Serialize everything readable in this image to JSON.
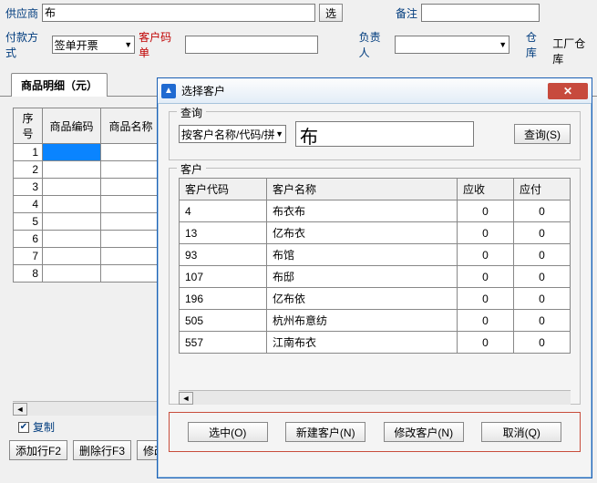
{
  "form": {
    "supplier_label": "供应商",
    "supplier_value": "布",
    "select_btn": "选",
    "remark_label": "备注",
    "remark_value": "",
    "pay_label": "付款方式",
    "pay_value": "签单开票",
    "cust_code_label": "客户码单",
    "cust_code_value": "",
    "owner_label": "负责人",
    "owner_value": "",
    "warehouse_label": "仓库",
    "warehouse_value": "工厂仓库",
    "tab_label": "商品明细（元）",
    "grid_headers": [
      "序号",
      "商品编码",
      "商品名称"
    ],
    "grid_rows": [
      "1",
      "2",
      "3",
      "4",
      "5",
      "6",
      "7",
      "8"
    ],
    "copy_label": "复制",
    "btn_addrow": "添加行F2",
    "btn_delrow": "删除行F3",
    "btn_mod": "修改"
  },
  "dialog": {
    "title": "选择客户",
    "query_group": "查询",
    "query_by": "按客户名称/代码/拼",
    "query_value": "布",
    "query_btn": "查询(S)",
    "customer_group": "客户",
    "headers": [
      "客户代码",
      "客户名称",
      "应收",
      "应付"
    ],
    "rows": [
      {
        "code": "4",
        "name": "布衣布",
        "ar": "0",
        "ap": "0"
      },
      {
        "code": "13",
        "name": "亿布衣",
        "ar": "0",
        "ap": "0"
      },
      {
        "code": "93",
        "name": "布馆",
        "ar": "0",
        "ap": "0"
      },
      {
        "code": "107",
        "name": "布邸",
        "ar": "0",
        "ap": "0"
      },
      {
        "code": "196",
        "name": "亿布依",
        "ar": "0",
        "ap": "0"
      },
      {
        "code": "505",
        "name": "杭州布意纺",
        "ar": "0",
        "ap": "0"
      },
      {
        "code": "557",
        "name": "江南布衣",
        "ar": "0",
        "ap": "0"
      }
    ],
    "btn_select": "选中(O)",
    "btn_new": "新建客户(N)",
    "btn_edit": "修改客户(N)",
    "btn_cancel": "取消(Q)"
  }
}
